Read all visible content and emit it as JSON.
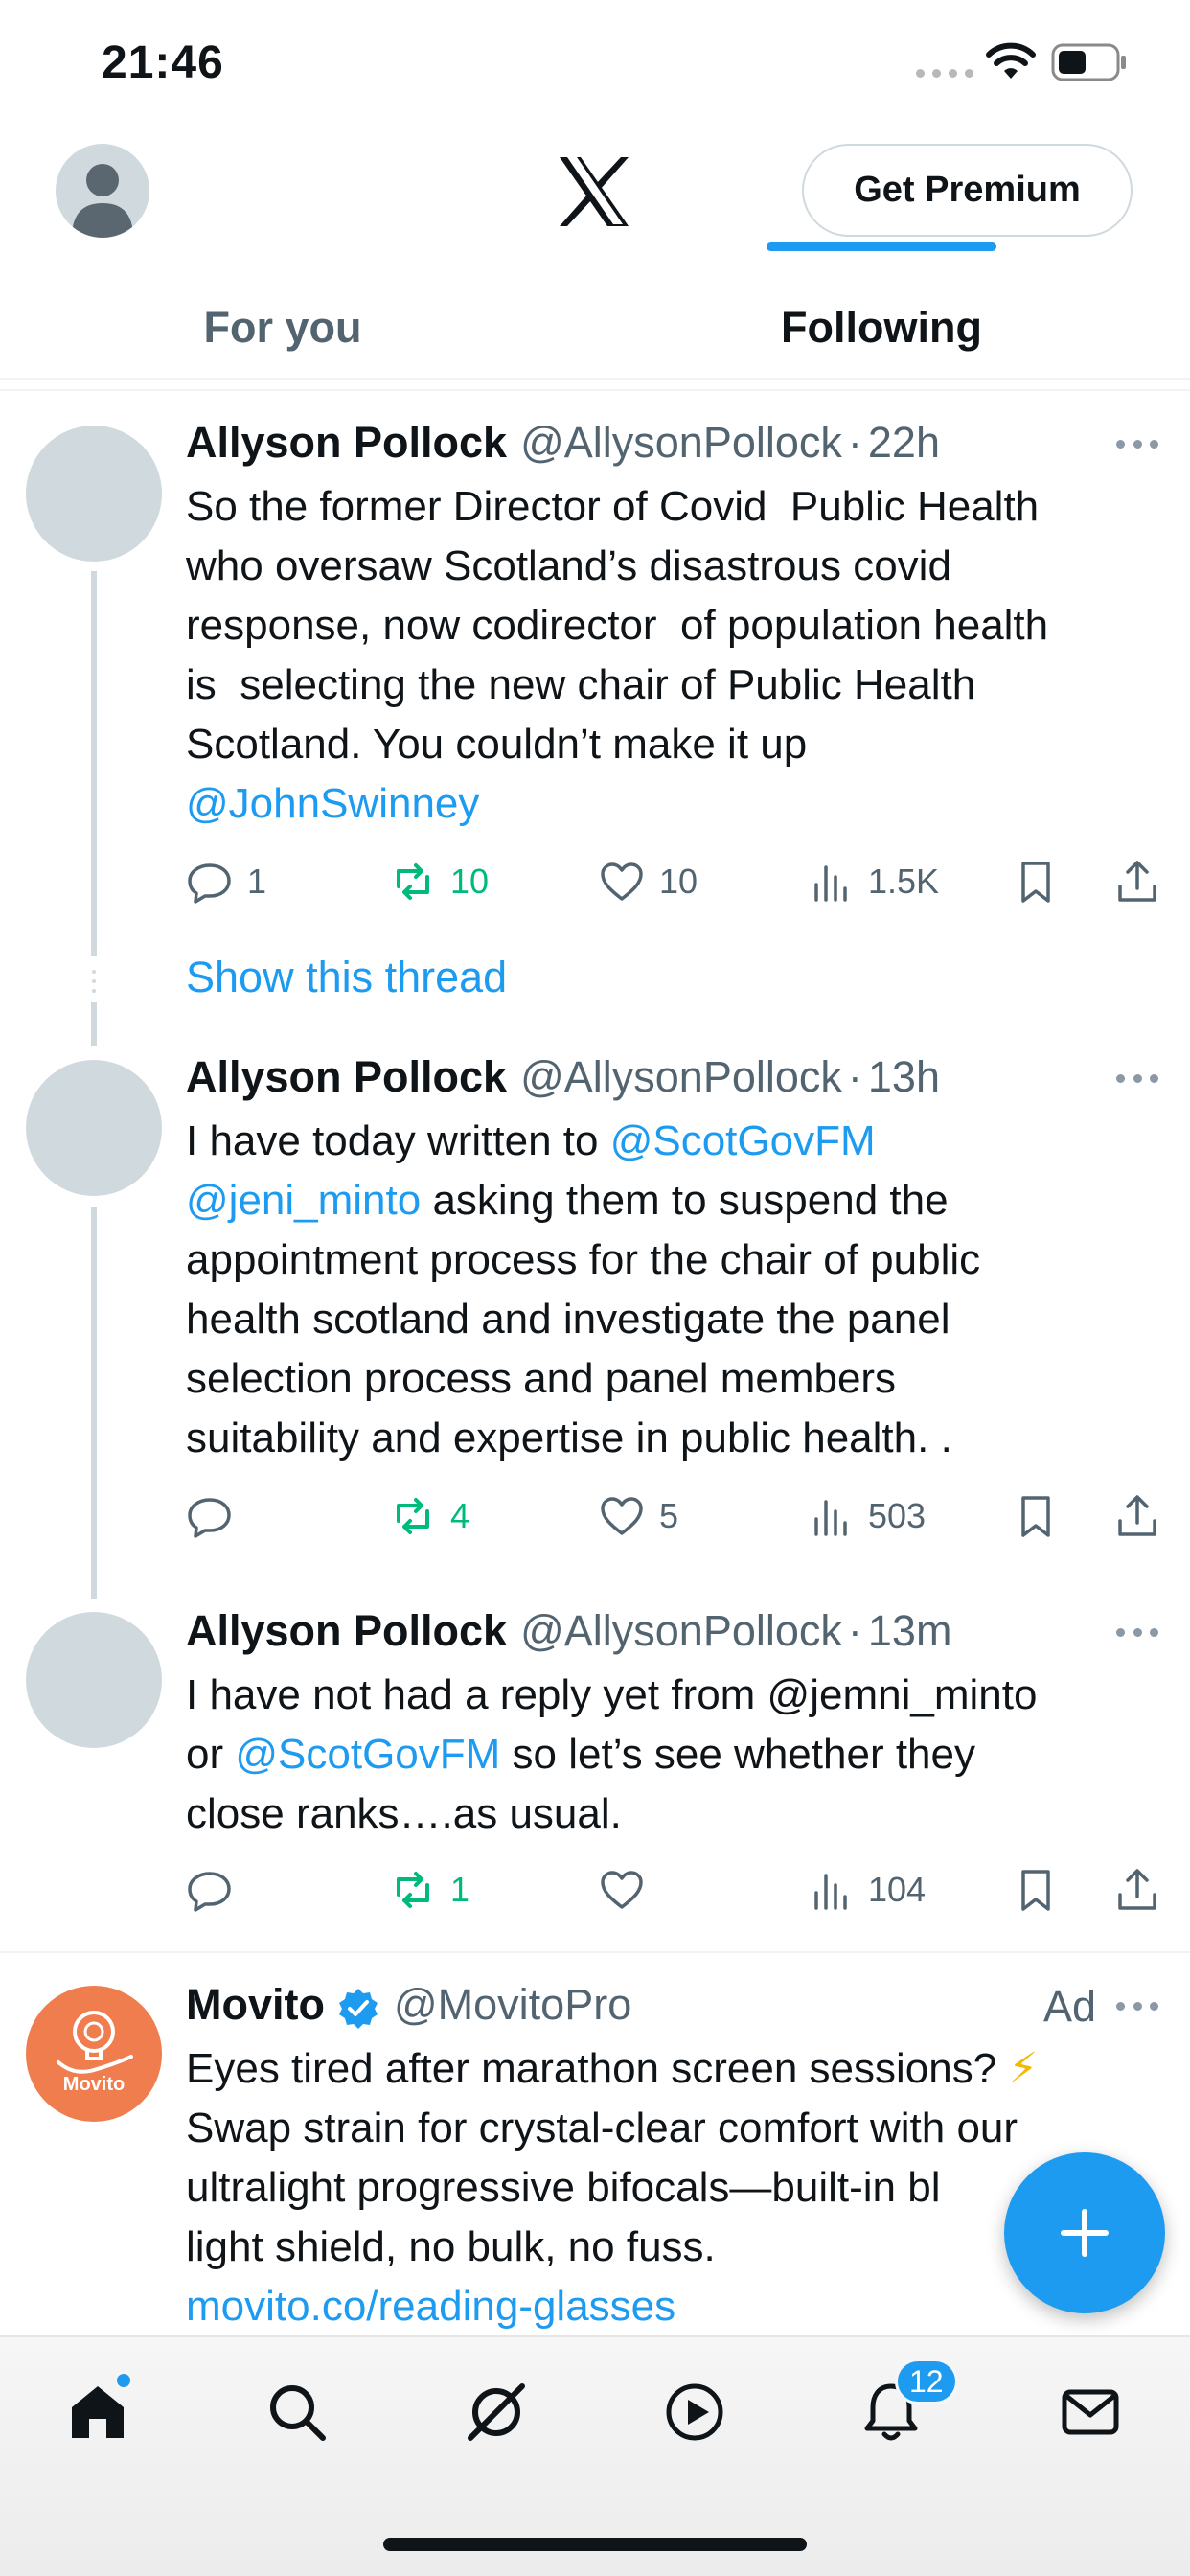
{
  "status_bar": {
    "time": "21:46"
  },
  "header": {
    "premium_label": "Get Premium"
  },
  "tabs": [
    {
      "label": "For you",
      "active": false
    },
    {
      "label": "Following",
      "active": true
    }
  ],
  "tweets": [
    {
      "name": "Allyson Pollock",
      "handle": "@AllysonPollock",
      "separator": "·",
      "time": "22h",
      "lines": [
        [
          {
            "text": "So the former Director of Covid  Public Health"
          }
        ],
        [
          {
            "text": "who oversaw Scotland’s disastrous covid"
          }
        ],
        [
          {
            "text": "response, now codirector  of population health"
          }
        ],
        [
          {
            "text": "is  selecting the new chair of Public Health"
          }
        ],
        [
          {
            "text": "Scotland. You couldn’t make it up"
          }
        ],
        [
          {
            "text": "@JohnSwinney",
            "mention": true
          }
        ]
      ],
      "replies": "1",
      "retweets": "10",
      "likes": "10",
      "views": "1.5K"
    },
    {
      "name": "Allyson Pollock",
      "handle": "@AllysonPollock",
      "separator": "·",
      "time": "13h",
      "lines": [
        [
          {
            "text": "I have today written to "
          },
          {
            "text": "@ScotGovFM",
            "mention": true
          }
        ],
        [
          {
            "text": "@jeni_minto",
            "mention": true
          },
          {
            "text": " asking them to suspend the"
          }
        ],
        [
          {
            "text": "appointment process for the chair of public"
          }
        ],
        [
          {
            "text": "health scotland and investigate the panel"
          }
        ],
        [
          {
            "text": "selection process and panel members"
          }
        ],
        [
          {
            "text": "suitability and expertise in public health. ."
          }
        ]
      ],
      "replies": "",
      "retweets": "4",
      "likes": "5",
      "views": "503"
    },
    {
      "name": "Allyson Pollock",
      "handle": "@AllysonPollock",
      "separator": "·",
      "time": "13m",
      "lines": [
        [
          {
            "text": "I have not had a reply yet from @jemni_minto"
          }
        ],
        [
          {
            "text": "or "
          },
          {
            "text": "@ScotGovFM",
            "mention": true
          },
          {
            "text": " so let’s see whether they"
          }
        ],
        [
          {
            "text": "close ranks….as usual."
          }
        ]
      ],
      "replies": "",
      "retweets": "1",
      "likes": "",
      "views": "104"
    }
  ],
  "show_thread_label": "Show this thread",
  "ad": {
    "name": "Movito",
    "handle": "@MovitoPro",
    "ad_label": "Ad",
    "avatar_text": "Movito",
    "lines": [
      [
        {
          "text": "Eyes tired after marathon screen sessions? "
        },
        {
          "text": "⚡",
          "bolt": true
        }
      ],
      [
        {
          "text": "Swap strain for crystal-clear comfort with our"
        }
      ],
      [
        {
          "text": "ultralight progressive bifocals—built-in bl"
        }
      ],
      [
        {
          "text": "light shield, no bulk, no fuss."
        }
      ],
      [
        {
          "text": "movito.co/reading-glasses",
          "mention": true
        }
      ]
    ]
  },
  "nav": {
    "items": [
      "home-icon",
      "search-icon",
      "grok-icon",
      "video-icon",
      "notifications-icon",
      "messages-icon"
    ],
    "notifications_badge": "12"
  },
  "colors": {
    "accent": "#1d9bf0",
    "retweet": "#00ba7c",
    "muted": "#536471"
  }
}
